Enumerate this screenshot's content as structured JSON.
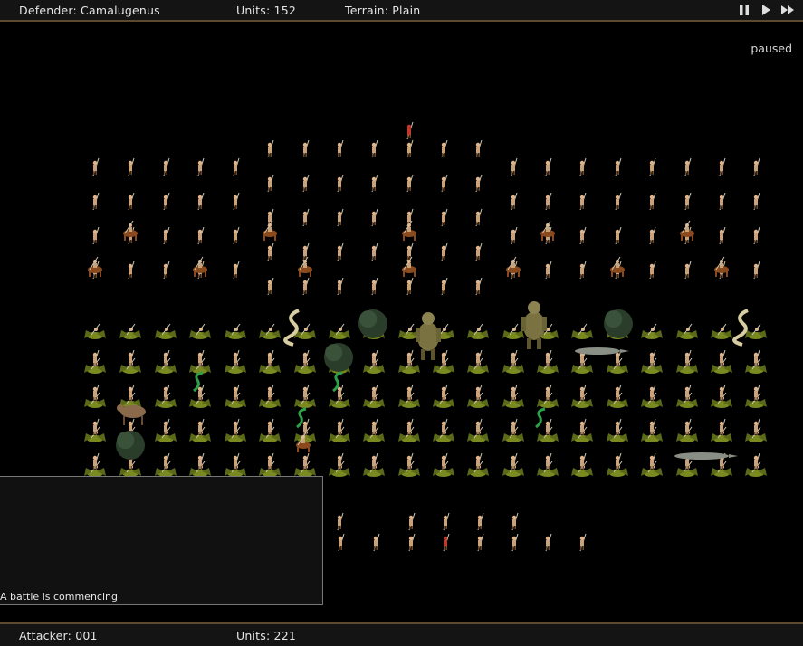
{
  "top_bar": {
    "defender": "Defender: Camalugenus",
    "units": "Units: 152",
    "terrain": "Terrain: Plain",
    "controls": [
      {
        "name": "pause-icon"
      },
      {
        "name": "play-icon"
      },
      {
        "name": "fast-forward-icon"
      }
    ]
  },
  "status": "paused",
  "battle_log": {
    "messages": [
      "A battle is commencing"
    ]
  },
  "bottom_bar": {
    "attacker": "Attacker: 001",
    "units": "Units: 221"
  },
  "colors": {
    "bar_bg": "#141414",
    "bar_border": "#5c4a2e",
    "soldier_body": "#c9a27a",
    "soldier_red": "#c0392b",
    "horse": "#8a4a1e",
    "dragon": "#7a8a20",
    "snake": "#2ea04a",
    "monster": "#7a7240",
    "bush": "#2a3d2a",
    "croc": "#8a8f86"
  }
}
